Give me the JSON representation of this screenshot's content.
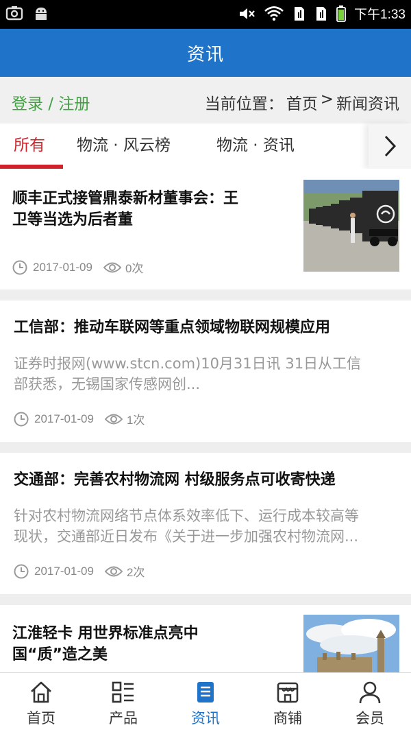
{
  "status_bar": {
    "time": "下午1:33"
  },
  "header": {
    "title": "资讯"
  },
  "location_bar": {
    "login_label": "登录 / 注册",
    "current_label": "当前位置：",
    "crumb_home": "首页",
    "crumb_sep": ">",
    "crumb_current": "新闻资讯"
  },
  "tabs": [
    {
      "label": "所有",
      "active": true
    },
    {
      "label": "物流 · 风云榜",
      "active": false
    },
    {
      "label": "物流 · 资讯",
      "active": false
    }
  ],
  "articles": [
    {
      "title_line1": "顺丰正式接管鼎泰新材董事会：王",
      "title_line2": "卫等当选为后者董",
      "date": "2017-01-09",
      "views": "0次",
      "has_thumb": true
    },
    {
      "title": "工信部：推动车联网等重点领域物联网规模应用",
      "desc_line1": "证券时报网(www.stcn.com)10月31日讯 31日从工信",
      "desc_line2": "部获悉，无锡国家传感网创...",
      "date": "2017-01-09",
      "views": "1次"
    },
    {
      "title": "交通部：完善农村物流网 村级服务点可收寄快递",
      "desc_line1": "针对农村物流网络节点体系效率低下、运行成本较高等",
      "desc_line2": "现状，交通部近日发布《关于进一步加强农村物流网...",
      "date": "2017-01-09",
      "views": "2次"
    },
    {
      "title_line1": "江淮轻卡 用世界标准点亮中",
      "title_line2": "国“质”造之美",
      "has_thumb": true
    }
  ],
  "bottom_nav": [
    {
      "label": "首页",
      "icon": "home-icon",
      "active": false
    },
    {
      "label": "产品",
      "icon": "list-icon",
      "active": false
    },
    {
      "label": "资讯",
      "icon": "news-icon",
      "active": true
    },
    {
      "label": "商铺",
      "icon": "shop-icon",
      "active": false
    },
    {
      "label": "会员",
      "icon": "user-icon",
      "active": false
    }
  ],
  "colors": {
    "accent_blue": "#1f74c9",
    "active_tab_red": "#d0222a",
    "login_green": "#42a142"
  }
}
